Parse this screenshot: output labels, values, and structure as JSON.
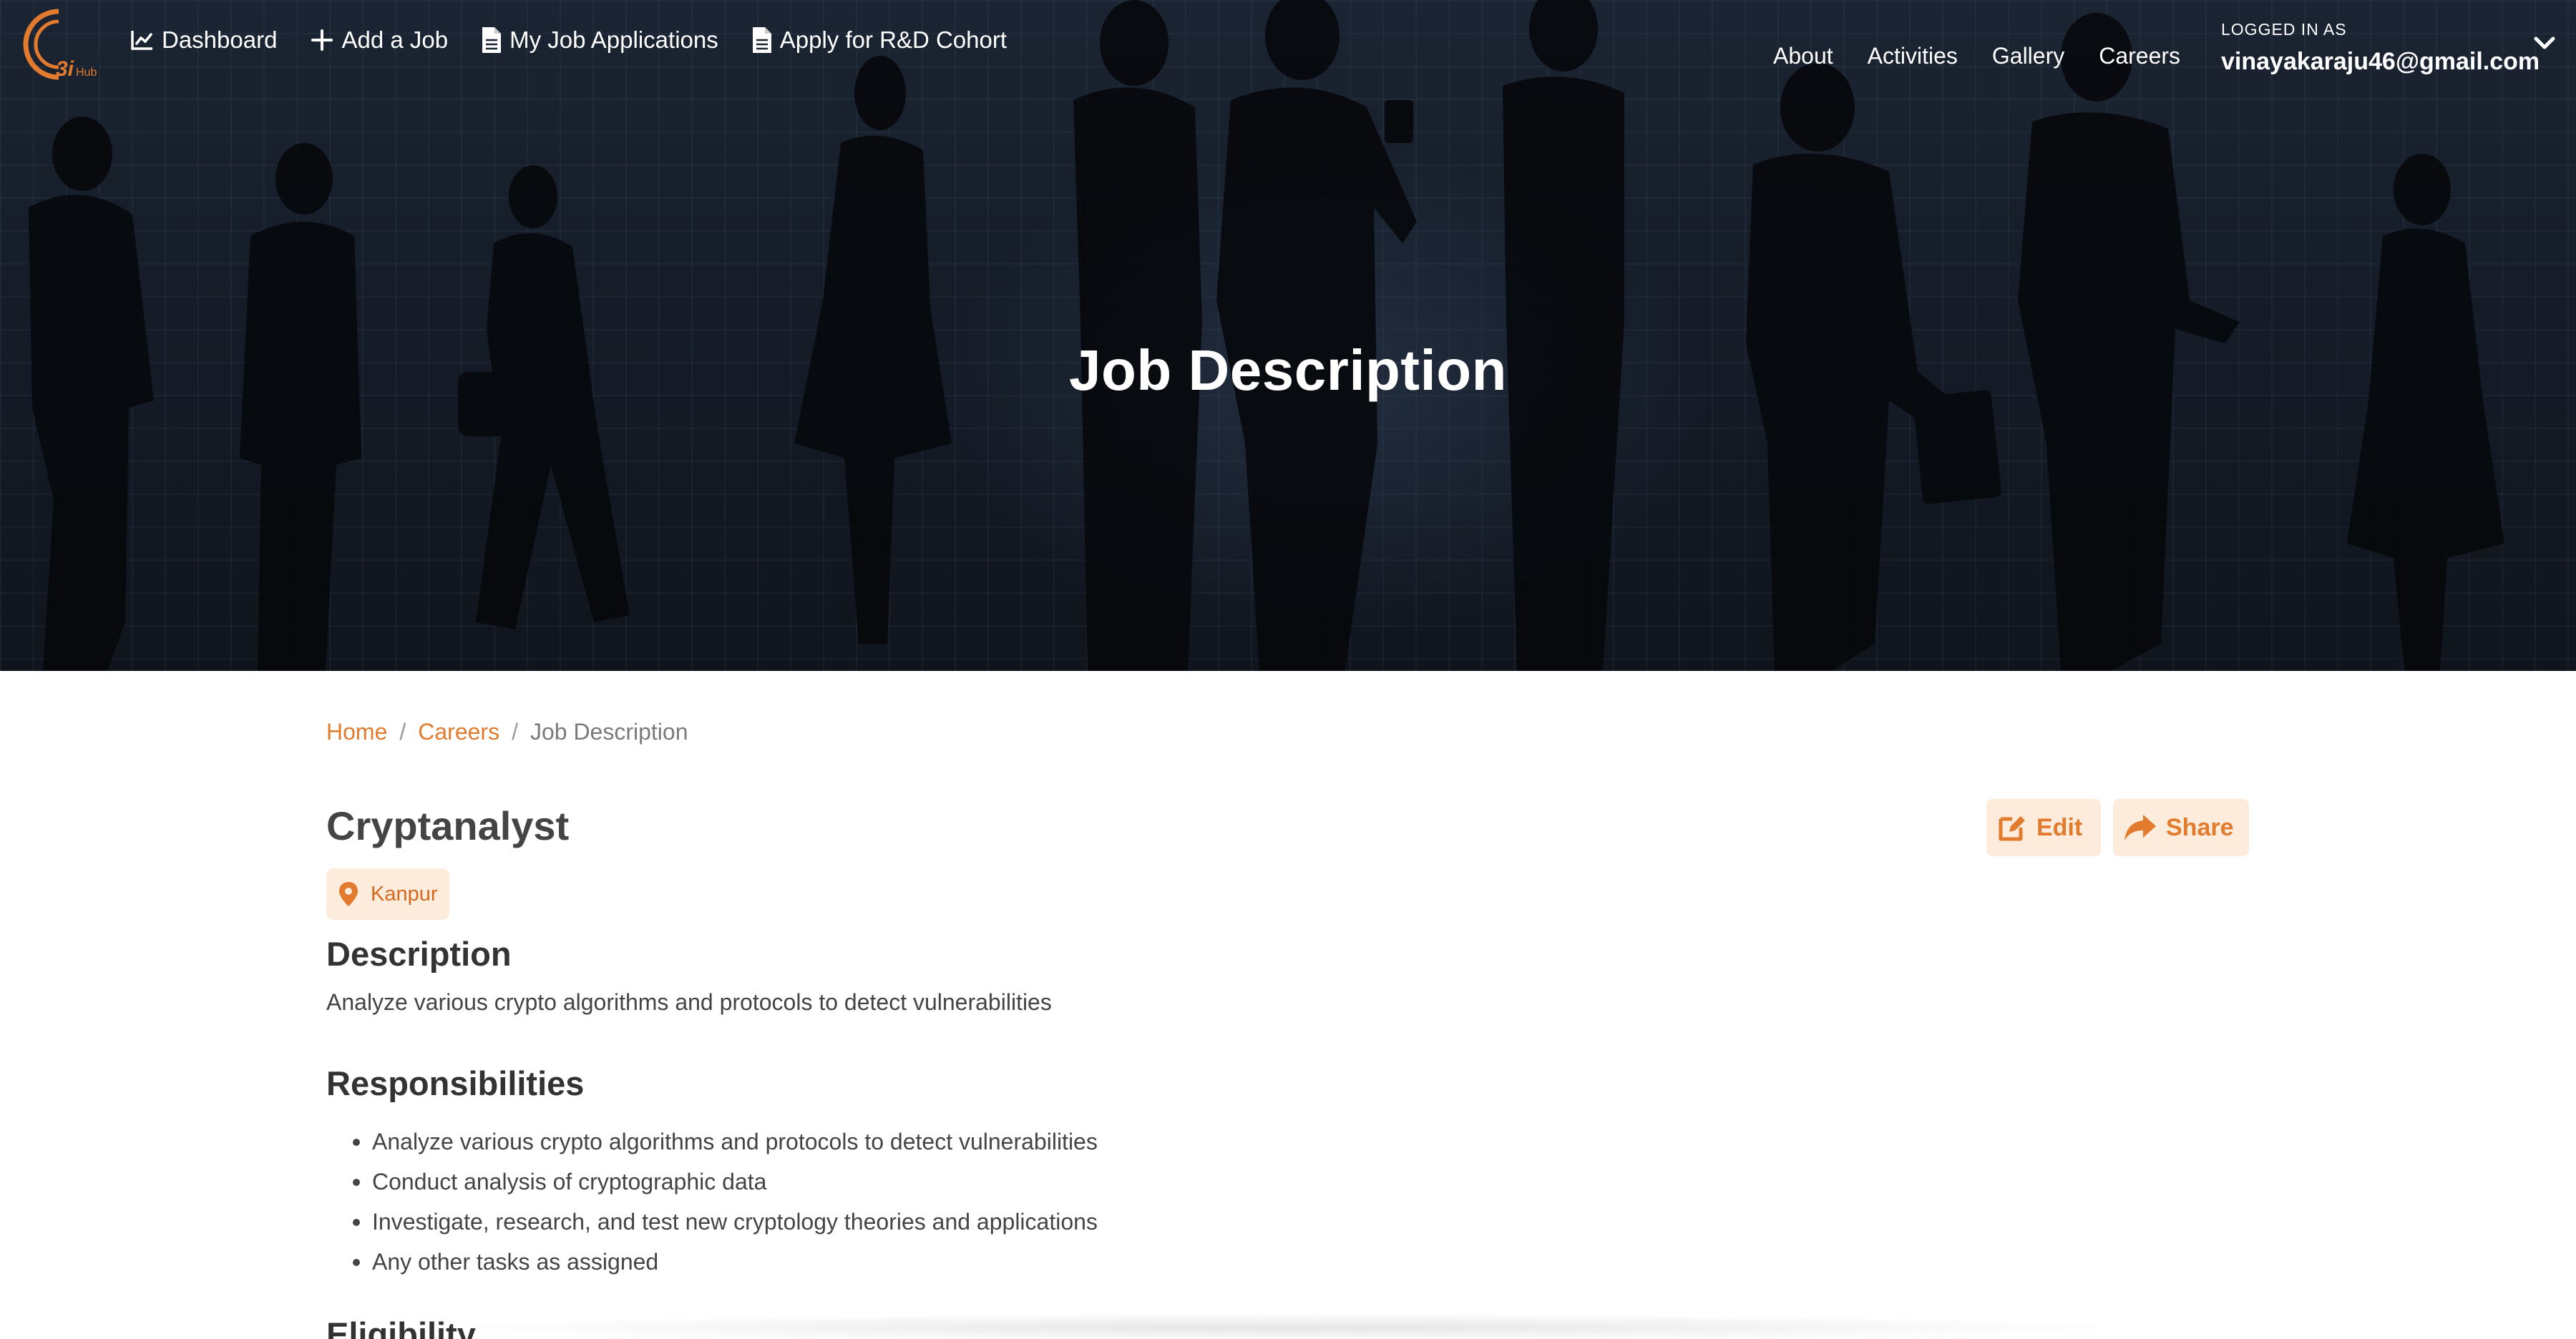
{
  "logo": {
    "text": "3i",
    "subtext": "Hub",
    "accent": "#e27b2e"
  },
  "nav": {
    "left": [
      {
        "label": "Dashboard",
        "icon": "chart-line-icon"
      },
      {
        "label": "Add a Job",
        "icon": "plus-icon"
      },
      {
        "label": "My Job Applications",
        "icon": "file-icon"
      },
      {
        "label": "Apply for R&D Cohort",
        "icon": "file-icon"
      }
    ],
    "right": [
      "About",
      "Activities",
      "Gallery",
      "Careers"
    ],
    "user": {
      "logged_in_label": "LOGGED IN AS",
      "email": "vinayakaraju46@gmail.com",
      "menu_icon": "chevron-down-icon"
    }
  },
  "hero": {
    "title": "Job Description"
  },
  "breadcrumb": {
    "items": [
      "Home",
      "Careers"
    ],
    "current": "Job Description",
    "separator": "/"
  },
  "job": {
    "title": "Cryptanalyst",
    "location": "Kanpur",
    "location_icon": "map-pin-icon",
    "actions": {
      "edit": "Edit",
      "share": "Share"
    },
    "description_heading": "Description",
    "description": "Analyze various crypto algorithms and protocols to detect vulnerabilities",
    "responsibilities_heading": "Responsibilities",
    "responsibilities": [
      "Analyze various crypto algorithms and protocols to detect vulnerabilities",
      "Conduct analysis of cryptographic data",
      "Investigate, research, and test new cryptology theories and applications",
      "Any other tasks as assigned"
    ],
    "eligibility_heading": "Eligibility"
  },
  "colors": {
    "accent": "#e27b2e",
    "accent_bg": "#fdecdc",
    "hero_bg": "#141b26",
    "text": "#444444"
  }
}
